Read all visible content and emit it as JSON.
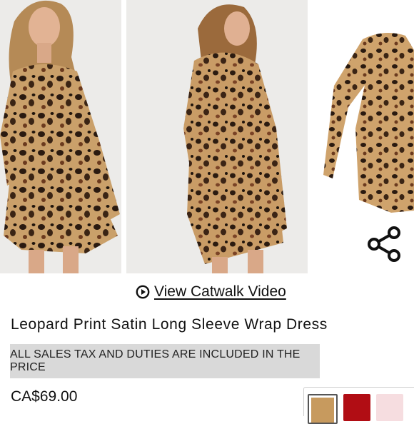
{
  "gallery": {
    "images": [
      {
        "icon": "model-front-photo"
      },
      {
        "icon": "model-angle-photo"
      },
      {
        "icon": "dress-flatlay-photo"
      }
    ],
    "share_icon": "share-icon"
  },
  "catwalk": {
    "icon": "play-circle-icon",
    "label": "View Catwalk Video"
  },
  "product": {
    "title": "Leopard Print Satin Long Sleeve Wrap Dress",
    "tax_notice": "ALL SALES TAX AND DUTIES ARE INCLUDED IN THE PRICE",
    "price": "CA$69.00"
  },
  "colors": {
    "swatches": [
      {
        "name": "leopard",
        "hex": "#c79a5e"
      },
      {
        "name": "red",
        "hex": "#b10d14"
      },
      {
        "name": "pink",
        "hex": "#f6dde0"
      }
    ]
  }
}
